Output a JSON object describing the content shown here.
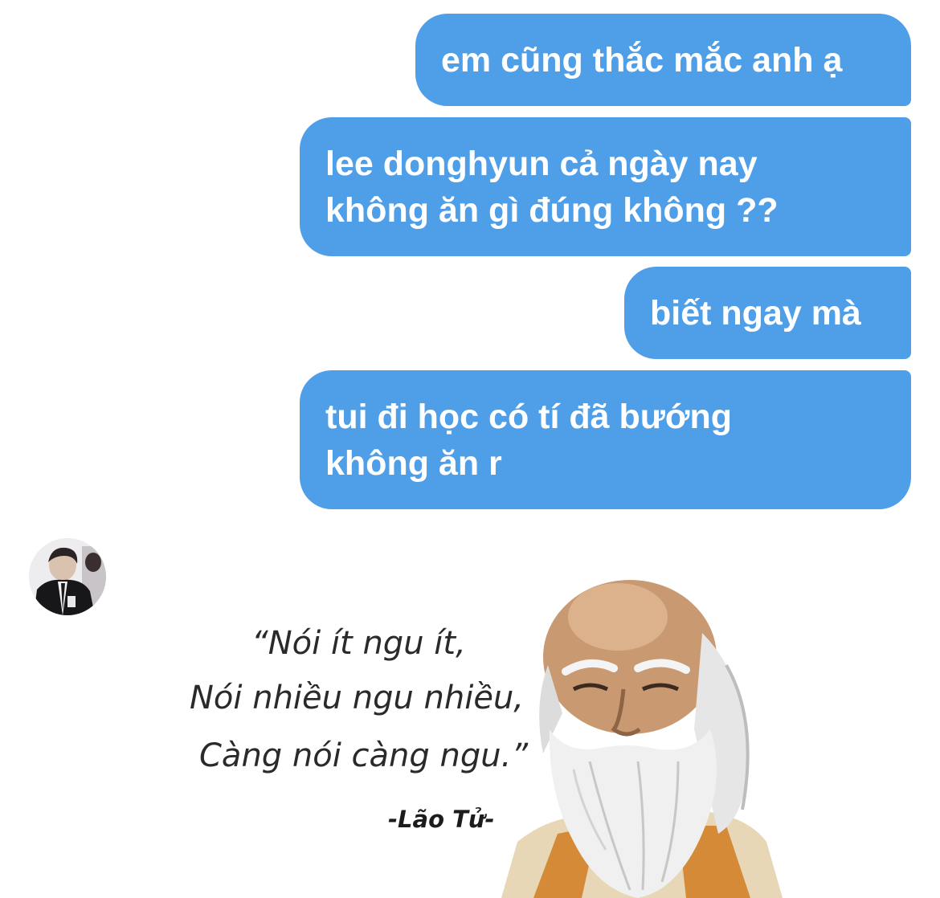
{
  "messages": [
    {
      "sender": "me",
      "text": "em cũng thắc mắc anh ạ"
    },
    {
      "sender": "me",
      "text": "lee donghyun cả ngày nay\nkhông ăn gì đúng không ??"
    },
    {
      "sender": "me",
      "text": "biết ngay mà"
    },
    {
      "sender": "me",
      "text": "tui đi học có tí đã bướng\nkhông ăn r"
    }
  ],
  "reply": {
    "sender": "other",
    "image": {
      "quote_lines": [
        "“Nói ít ngu ít,",
        "Nói nhiều ngu nhiều,",
        "Càng nói càng ngu.”"
      ],
      "author": "-Lão Tử-"
    }
  },
  "colors": {
    "bubble": "#4f9ee8",
    "bubble_text": "#ffffff",
    "background": "#ffffff"
  }
}
